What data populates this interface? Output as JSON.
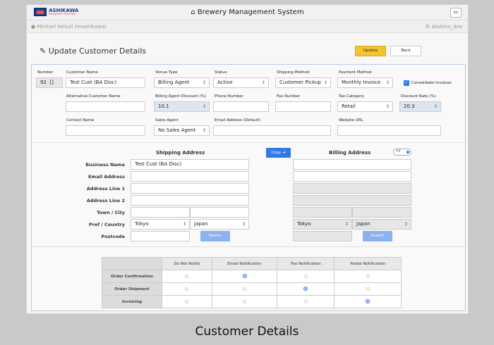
{
  "header": {
    "logo_main": "ASHIKAWA",
    "logo_sub": "BREWERY SYSTEMS",
    "app_title": "Brewery Management System",
    "home_icon": "home-icon",
    "logout_icon": "logout-icon"
  },
  "userbar": {
    "user": "Michael Kelsall (mashikawa)",
    "db": "absbms_dev"
  },
  "page": {
    "title": "Update Customer Details",
    "update_label": "Update",
    "back_label": "Back"
  },
  "form": {
    "number_label": "Number",
    "number_value": "92",
    "number_flag": "[]",
    "customer_name_label": "Customer Name",
    "customer_name_value": "Test Cust (BA Disc)",
    "venue_type_label": "Venue Type",
    "venue_type_value": "Billing Agent",
    "status_label": "Status",
    "status_value": "Active",
    "shipping_method_label": "Shipping Method",
    "shipping_method_value": "Customer Pickup",
    "payment_method_label": "Payment Method",
    "payment_method_value": "Monthly Invoice",
    "consolidate_label": "Consolidate Invoices",
    "consolidate_checked": true,
    "alt_name_label": "Alternative Customer Name",
    "alt_name_value": "",
    "ba_discount_label": "Billing Agent Discount (%)",
    "ba_discount_value": "10.1",
    "phone_label": "Phone Number",
    "phone_value": "",
    "fax_label": "Fax Number",
    "fax_value": "",
    "tax_label": "Tax Category",
    "tax_value": "Retail",
    "discount_rate_label": "Discount Rate (%)",
    "discount_rate_value": "20.3",
    "contact_label": "Contact Name",
    "contact_value": "",
    "sales_agent_label": "Sales Agent",
    "sales_agent_value": "No Sales Agent",
    "email_label": "Email Address (Default)",
    "email_value": "",
    "website_label": "Website URL",
    "website_value": ""
  },
  "address": {
    "shipping_title": "Shipping Address",
    "billing_title": "Billing Address",
    "copy_label": "Copy",
    "toggle_label": "Off",
    "labels": {
      "business_name": "Business Name",
      "email": "Email Address",
      "line1": "Address Line 1",
      "line2": "Address Line 2",
      "town": "Town / City",
      "pref": "Pref / Country",
      "postcode": "Postcode"
    },
    "shipping": {
      "business_name": "Test Cust (BA Disc)",
      "pref": "Tokyo",
      "country": "Japan"
    },
    "billing": {
      "pref": "Tokyo",
      "country": "Japan"
    },
    "search_label": "Search"
  },
  "notifications": {
    "columns": [
      "Do Not Notify",
      "Email Notification",
      "Fax Notification",
      "Postal Notification"
    ],
    "rows": [
      {
        "label": "Order Confirmation",
        "selected": 1
      },
      {
        "label": "Order Shipment",
        "selected": 2
      },
      {
        "label": "Invoicing",
        "selected": 3
      }
    ]
  },
  "caption": "Customer Details",
  "colors": {
    "update_button": "#f4c430",
    "primary": "#3478e6",
    "panel_border": "#b8cce4"
  }
}
